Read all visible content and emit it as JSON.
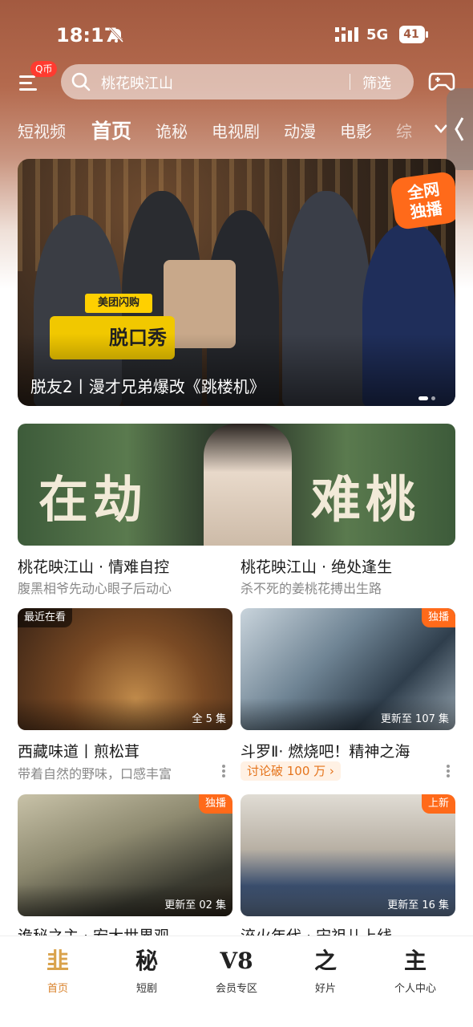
{
  "status_bar": {
    "time": "18:17",
    "network": "5G",
    "battery": "41"
  },
  "search": {
    "coin_badge": "Q币",
    "query": "桃花映江山",
    "filter_label": "筛选"
  },
  "tabs": [
    {
      "label": "短视频"
    },
    {
      "label": "首页"
    },
    {
      "label": "诡秘"
    },
    {
      "label": "电视剧"
    },
    {
      "label": "动漫"
    },
    {
      "label": "电影"
    },
    {
      "label": "综"
    }
  ],
  "banner": {
    "caption": "脱友2丨漫才兄弟爆改《跳楼机》",
    "badge_line1": "全网",
    "badge_line2": "独播",
    "sponsor": "美团闪购",
    "show_logo": "脱口秀"
  },
  "promo": {
    "left_word": "在劫",
    "right_word": "难桃",
    "items": [
      {
        "title": "桃花映江山 · 情难自控",
        "subtitle": "腹黑相爷先动心眼子后动心"
      },
      {
        "title": "桃花映江山 · 绝处逢生",
        "subtitle": "杀不死的姜桃花搏出生路"
      }
    ]
  },
  "row1": [
    {
      "tag": "最近在看",
      "episodes": "全 5 集",
      "title": "西藏味道丨煎松茸",
      "subtitle": "带着自然的野味，口感丰富"
    },
    {
      "tag": "独播",
      "episodes": "更新至 107 集",
      "title": "斗罗Ⅱ· 燃烧吧！精神之海",
      "hot": "讨论破 100 万 ›"
    }
  ],
  "row2": [
    {
      "tag": "独播",
      "episodes": "更新至 02 集",
      "title": "诡秘之主 · 宏大世界观"
    },
    {
      "tag": "上新",
      "episodes": "更新至 16 集",
      "title": "淬火年代 · 宋祖儿上线"
    }
  ],
  "bottom_nav": [
    {
      "glyph": "韭",
      "label": "首页"
    },
    {
      "glyph": "秘",
      "label": "短剧"
    },
    {
      "glyph": "V8",
      "label": "会员专区"
    },
    {
      "glyph": "之",
      "label": "好片"
    },
    {
      "glyph": "主",
      "label": "个人中心"
    }
  ],
  "colors": {
    "accent": "#ff6a1a",
    "header": "#a35a40",
    "active_nav": "#d9822b"
  }
}
